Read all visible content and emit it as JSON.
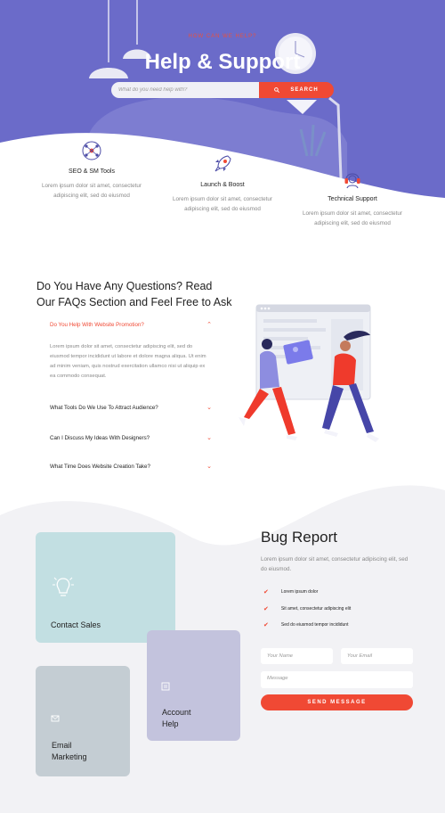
{
  "colors": {
    "hero_bg": "#6b6bc9",
    "accent": "#f04934",
    "contact_card": "#c2dfe2",
    "account_card": "#c3c3dd",
    "email_card": "#c4cdd3",
    "bottom_bg": "#f2f2f5"
  },
  "hero": {
    "eyebrow": "HOW CAN WE HELP?",
    "title": "Help & Support",
    "search_placeholder": "What do you need help with?",
    "search_button": "SEARCH"
  },
  "features": [
    {
      "icon": "network-icon",
      "title": "SEO & SM Tools",
      "text": "Lorem ipsum dolor sit amet, consectetur adipiscing elit, sed do eiusmod"
    },
    {
      "icon": "rocket-icon",
      "title": "Launch & Boost",
      "text": "Lorem ipsum dolor sit amet, consectetur adipiscing elit, sed do eiusmod"
    },
    {
      "icon": "headset-icon",
      "title": "Technical Support",
      "text": "Lorem ipsum dolor sit amet, consectetur adipiscing elit, sed do eiusmod"
    }
  ],
  "faq": {
    "title": "Do You Have Any Questions? Read Our FAQs Section and Feel Free to Ask",
    "items": [
      {
        "question": "Do You Help With Website Promotion?",
        "expanded": true
      },
      {
        "question": "What Tools Do We Use To Attract Audience?",
        "expanded": false
      },
      {
        "question": "Can I Discuss My Ideas With Designers?",
        "expanded": false
      },
      {
        "question": "What Time Does Website Creation Take?",
        "expanded": false
      }
    ],
    "answer": "Lorem ipsum dolor sit amet, consectetur adipiscing elit, sed do eiusmod tempor incididunt ut labore et dolore magna aliqua. Ut enim ad minim veniam, quis nostrud exercitation ullamco nisi ut aliquip ex ea commodo consequat."
  },
  "cards": [
    {
      "label": "Contact Sales",
      "icon": "lightbulb-icon"
    },
    {
      "label": "Account Help",
      "icon": "document-icon"
    },
    {
      "label": "Email Marketing",
      "icon": "envelope-icon"
    }
  ],
  "bug_report": {
    "title": "Bug Report",
    "description": "Lorem ipsum dolor sit amet, consectetur adipiscing elit, sed do eiusmod.",
    "checks": [
      "Lorem ipsum dolor",
      "Sit amet, consectetur adipiscing elit",
      "Sed do eiusmod tempor incididunt"
    ],
    "name_placeholder": "Your Name",
    "email_placeholder": "Your Email",
    "message_placeholder": "Message",
    "send_button": "SEND MESSAGE"
  }
}
